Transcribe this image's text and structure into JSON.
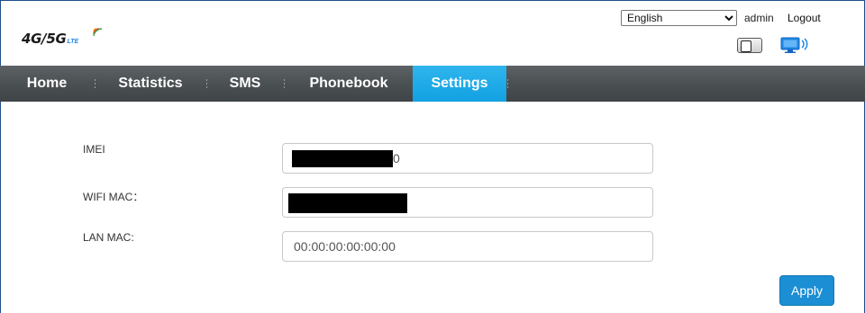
{
  "header": {
    "logo_text": "4G/5G",
    "logo_sub": "LTE",
    "language": {
      "selected": "English",
      "options": [
        "English"
      ]
    },
    "user": "admin",
    "logout_label": "Logout",
    "icons": [
      "sim-status-icon",
      "network-status-icon"
    ]
  },
  "nav": {
    "items": [
      {
        "label": "Home",
        "active": false
      },
      {
        "label": "Statistics",
        "active": false
      },
      {
        "label": "SMS",
        "active": false
      },
      {
        "label": "Phonebook",
        "active": false
      },
      {
        "label": "Settings",
        "active": true
      }
    ],
    "active_color": "#12a1e2"
  },
  "form": {
    "imei": {
      "label": "IMEI",
      "value_visible": "0"
    },
    "wifi_mac": {
      "label": "WIFI MAC：",
      "value_visible": ""
    },
    "lan_mac": {
      "label": "LAN MAC:",
      "value": "00:00:00:00:00:00"
    },
    "apply_label": "Apply"
  },
  "colors": {
    "accent": "#1b8ed4",
    "nav_bg": "#4b5053"
  }
}
